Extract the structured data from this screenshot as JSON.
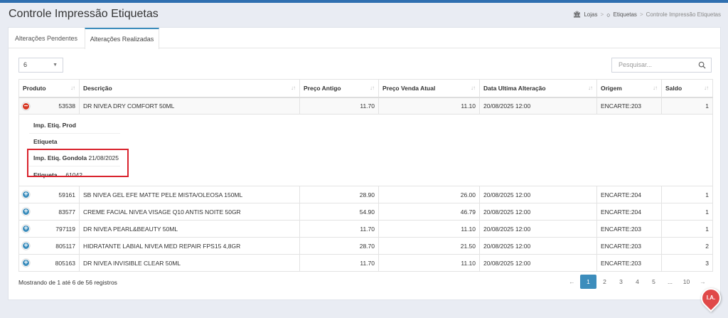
{
  "page": {
    "title": "Controle Impressão Etiquetas"
  },
  "breadcrumb": {
    "home": "Lojas",
    "section": "Etiquetas",
    "current": "Controle Impressão Etiquetas"
  },
  "tabs": [
    {
      "label": "Alterações Pendentes"
    },
    {
      "label": "Alterações Realizadas"
    }
  ],
  "controls": {
    "page_size": "6",
    "search_placeholder": "Pesquisar..."
  },
  "table": {
    "columns": [
      "Produto",
      "Descrição",
      "Preço Antigo",
      "Preço Venda Atual",
      "Data Ultima Alteração",
      "Origem",
      "Saldo"
    ],
    "rows": [
      {
        "produto": "53538",
        "descricao": "DR NIVEA DRY COMFORT 50ML",
        "preco_antigo": "11.70",
        "preco_atual": "11.10",
        "data": "20/08/2025 12:00",
        "origem": "ENCARTE:203",
        "saldo": "1"
      },
      {
        "produto": "59161",
        "descricao": "SB NIVEA GEL EFE MATTE PELE MISTA/OLEOSA 150ML",
        "preco_antigo": "28.90",
        "preco_atual": "26.00",
        "data": "20/08/2025 12:00",
        "origem": "ENCARTE:204",
        "saldo": "1"
      },
      {
        "produto": "83577",
        "descricao": "CREME FACIAL NIVEA VISAGE Q10 ANTIS NOITE 50GR",
        "preco_antigo": "54.90",
        "preco_atual": "46.79",
        "data": "20/08/2025 12:00",
        "origem": "ENCARTE:204",
        "saldo": "1"
      },
      {
        "produto": "797119",
        "descricao": "DR NIVEA PEARL&BEAUTY 50ML",
        "preco_antigo": "11.70",
        "preco_atual": "11.10",
        "data": "20/08/2025 12:00",
        "origem": "ENCARTE:203",
        "saldo": "1"
      },
      {
        "produto": "805117",
        "descricao": "HIDRATANTE LABIAL NIVEA MED REPAIR FPS15 4,8GR",
        "preco_antigo": "28.70",
        "preco_atual": "21.50",
        "data": "20/08/2025 12:00",
        "origem": "ENCARTE:203",
        "saldo": "2"
      },
      {
        "produto": "805163",
        "descricao": "DR NIVEA INVISIBLE CLEAR 50ML",
        "preco_antigo": "11.70",
        "preco_atual": "11.10",
        "data": "20/08/2025 12:00",
        "origem": "ENCARTE:203",
        "saldo": "3"
      }
    ]
  },
  "details": {
    "imp_etiq_prod_label": "Imp. Etiq. Prod",
    "etiqueta_label_1": "Etiqueta",
    "imp_etiq_gondola_label": "Imp. Etiq. Gondola",
    "imp_etiq_gondola_value": "21/08/2025",
    "etiqueta_label_2": "Etiqueta",
    "etiqueta_value_2": "61042"
  },
  "footer": {
    "info": "Mostrando de 1 até 6 de 56 registros",
    "pages": [
      "1",
      "2",
      "3",
      "4",
      "5",
      "...",
      "10"
    ],
    "prev": "←",
    "next": "→"
  },
  "fab": {
    "label": "I.A."
  },
  "colors": {
    "accent": "#3c8dbc",
    "danger": "#d73925",
    "highlight": "#d9232d"
  }
}
